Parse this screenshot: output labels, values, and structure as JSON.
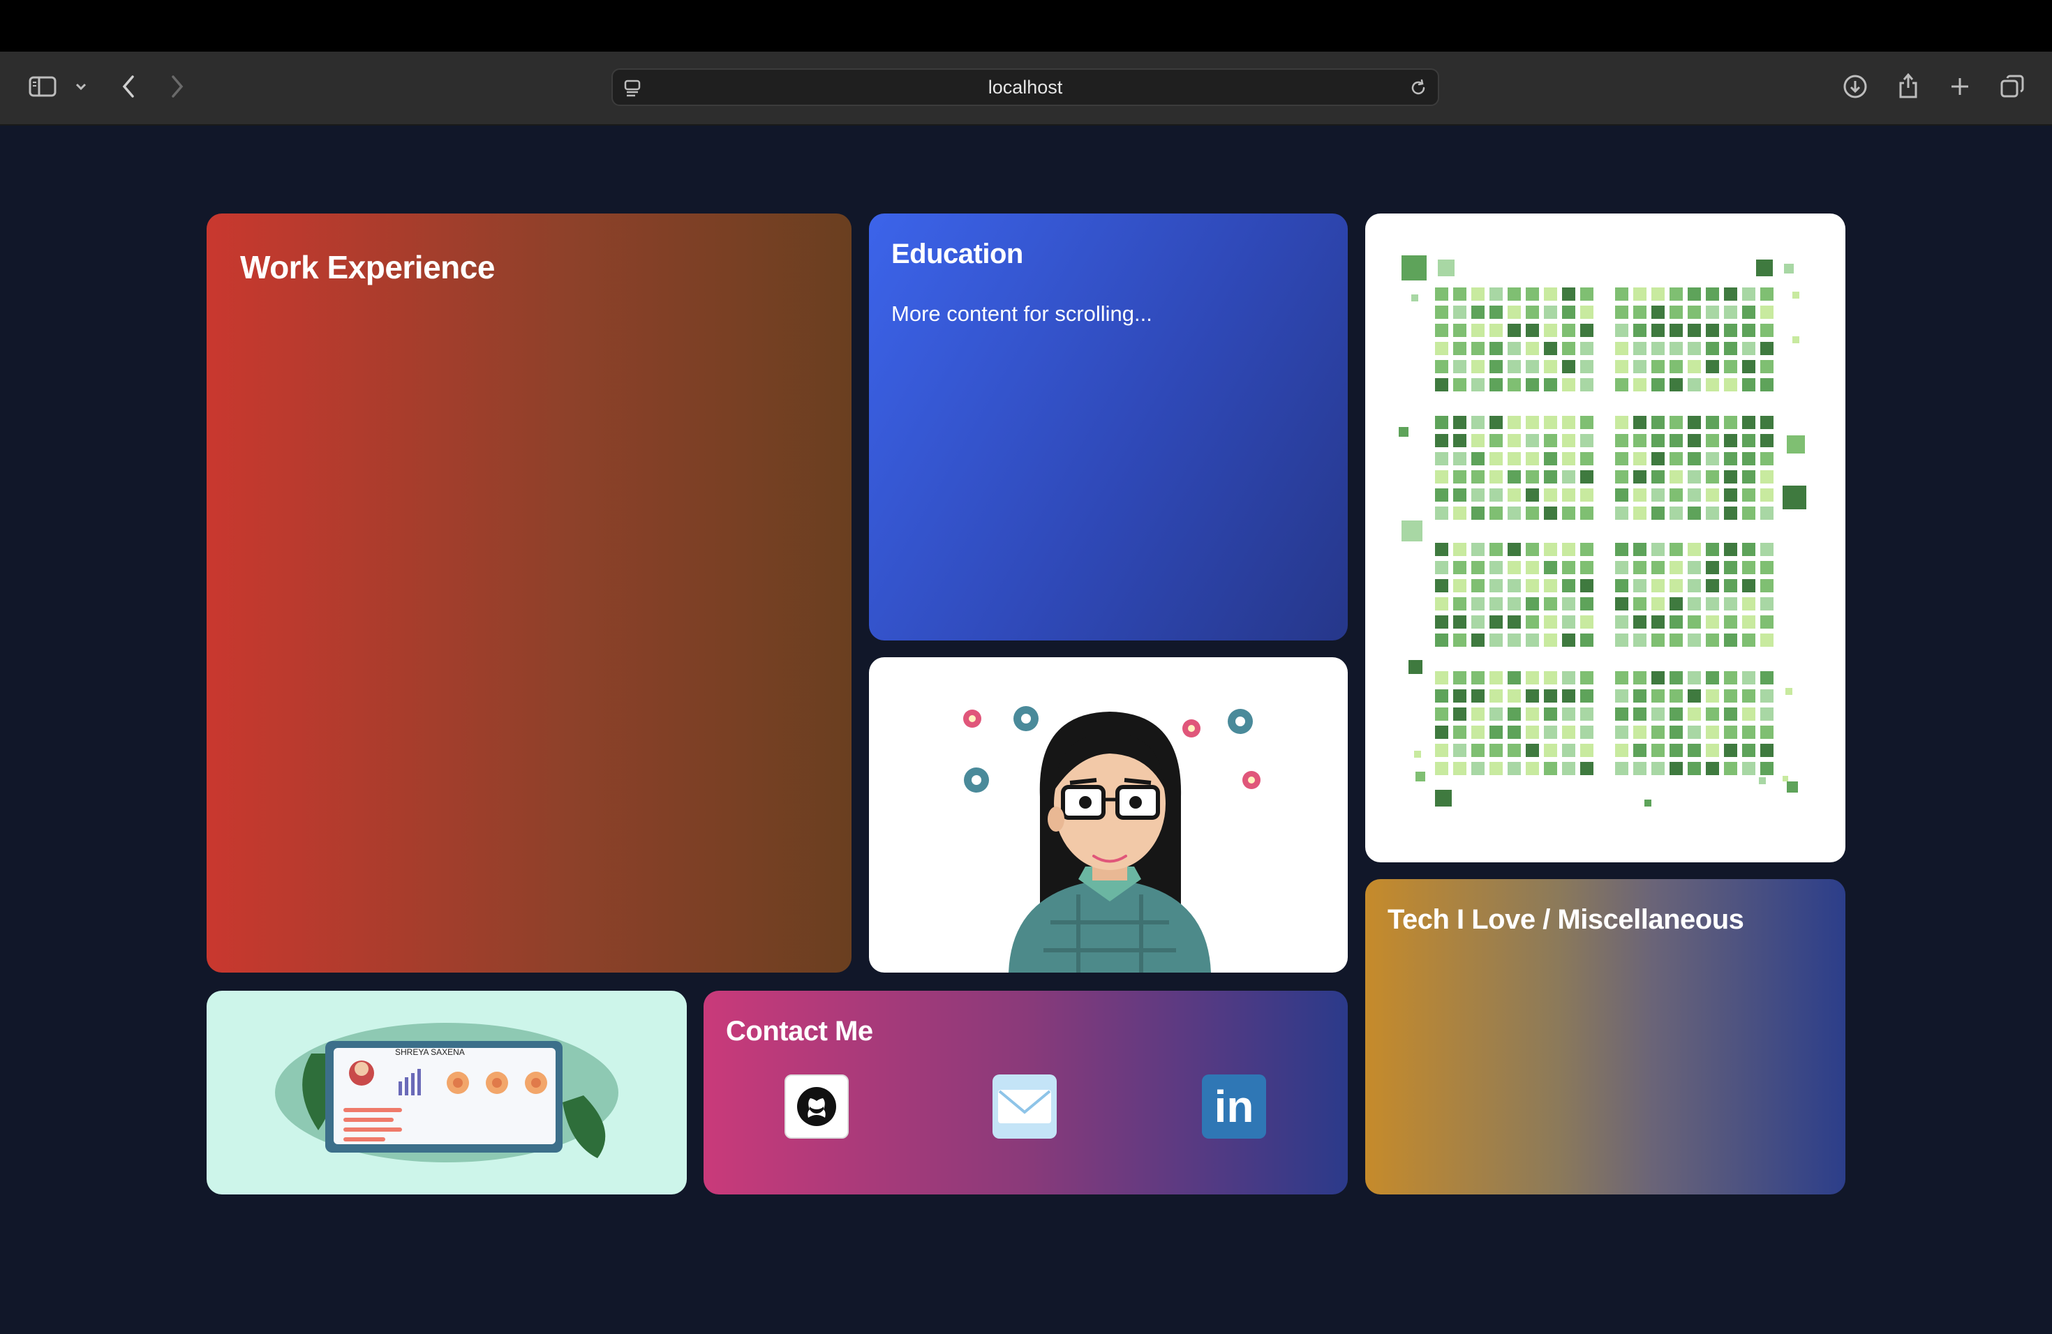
{
  "browser": {
    "address": "localhost",
    "icons": [
      "sidebar-icon",
      "chevron-down-icon",
      "back-icon",
      "forward-icon",
      "site-settings-icon",
      "reload-icon",
      "download-icon",
      "share-icon",
      "new-tab-icon",
      "tabs-overview-icon"
    ]
  },
  "cards": {
    "work": {
      "title": "Work Experience"
    },
    "education": {
      "title": "Education",
      "body": "More content for scrolling..."
    },
    "tech": {
      "title": "Tech I Love / Miscellaneous"
    },
    "contact": {
      "title": "Contact Me"
    },
    "resume": {
      "name": "SHREYA SAXENA"
    }
  },
  "contact_links": [
    {
      "name": "github-icon"
    },
    {
      "name": "email-icon"
    },
    {
      "name": "linkedin-icon",
      "text": "in"
    }
  ],
  "colors": {
    "page_bg": "#111729",
    "work_gradient": [
      "#c9382f",
      "#6a3f20"
    ],
    "education_gradient": [
      "#3c64ea",
      "#26378a"
    ],
    "contact_gradient": [
      "#c93a7a",
      "#2b3a8a"
    ],
    "tech_gradient": [
      "#c68b2b",
      "#2c3e8a"
    ],
    "resume_bg": "#cdf5ea",
    "contribution_greens": [
      "#c8ea9f",
      "#a8d7a4",
      "#7fbf72",
      "#5ea35a",
      "#3f7a3f"
    ]
  }
}
